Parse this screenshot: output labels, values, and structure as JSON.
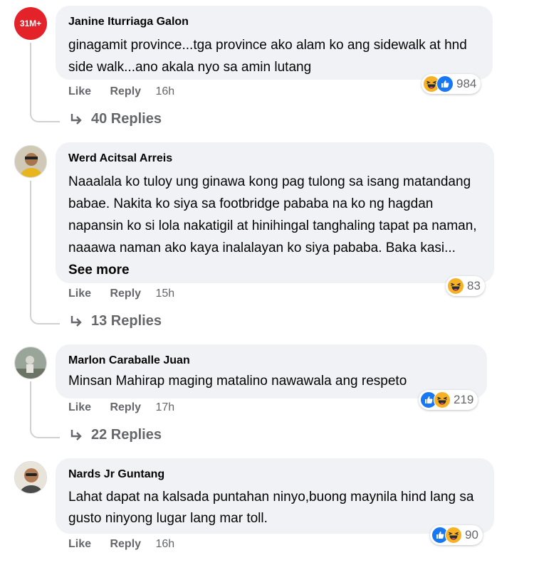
{
  "colors": {
    "bubble": "#f0f2f5",
    "secondary_text": "#65676b",
    "like_blue": "#1877f2",
    "haha_yellow": "#f7b125",
    "badge_red": "#e4222a"
  },
  "comments": [
    {
      "author": "Janine Iturriaga Galon",
      "avatar_badge": "31M+",
      "text": "ginagamit province...tga province ako alam ko ang sidewalk at hnd side walk...ano akala nyo sa amin lutang",
      "like_label": "Like",
      "reply_label": "Reply",
      "time": "16h",
      "reactions": [
        "haha-icon",
        "like-icon"
      ],
      "reaction_count": "984",
      "replies_label": "40 Replies"
    },
    {
      "author": "Werd Acitsal Arreis",
      "text": "Naaalala ko tuloy ung ginawa kong pag tulong sa isang matandang babae. Nakita ko siya sa footbridge pababa na ko ng hagdan napansin ko si lola nakatigil at hinihingal tanghaling tapat pa naman, naaawa naman ako kaya inalalayan ko siya pababa. Baka kasi...",
      "see_more": "See more",
      "like_label": "Like",
      "reply_label": "Reply",
      "time": "15h",
      "reactions": [
        "haha-icon"
      ],
      "reaction_count": "83",
      "replies_label": "13 Replies"
    },
    {
      "author": "Marlon Caraballe Juan",
      "text": "Minsan Mahirap maging matalino nawawala ang respeto",
      "like_label": "Like",
      "reply_label": "Reply",
      "time": "17h",
      "reactions": [
        "like-icon",
        "haha-icon"
      ],
      "reaction_count": "219",
      "replies_label": "22 Replies"
    },
    {
      "author": "Nards Jr Guntang",
      "text": "Lahat dapat na kalsada puntahan ninyo,buong maynila hind lang sa gusto ninyong lugar lang mar toll.",
      "like_label": "Like",
      "reply_label": "Reply",
      "time": "16h",
      "reactions": [
        "like-icon",
        "haha-icon"
      ],
      "reaction_count": "90"
    }
  ]
}
